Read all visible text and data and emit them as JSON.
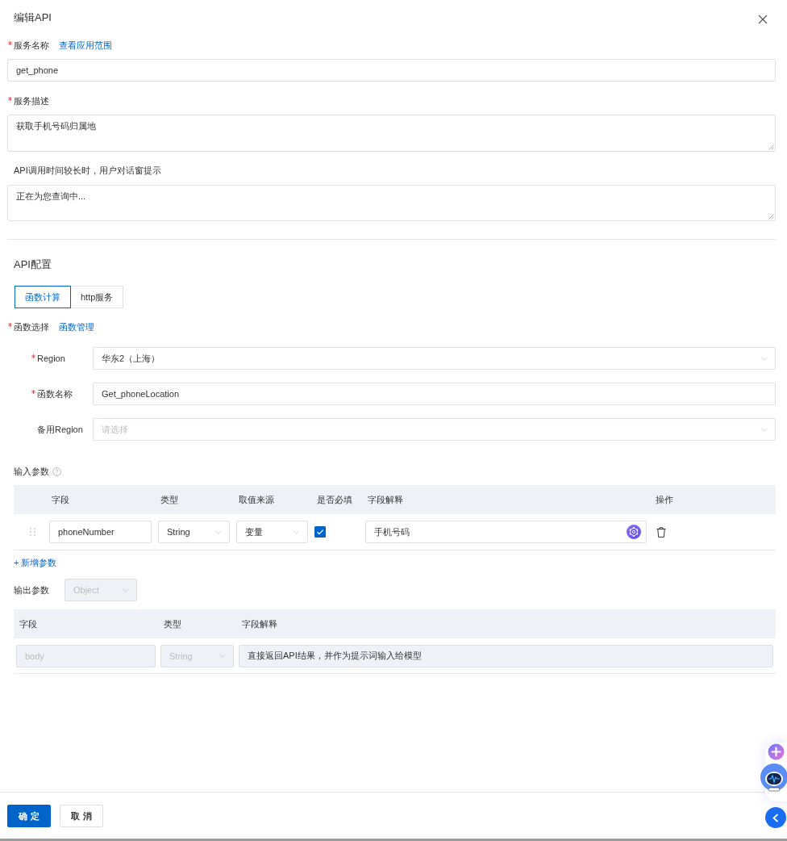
{
  "dialog": {
    "title": "编辑API"
  },
  "service_name": {
    "label": "服务名称",
    "required": true,
    "link": "查看应用范围",
    "value": "get_phone"
  },
  "service_description": {
    "label": "服务描述",
    "required": true,
    "value": "获取手机号码归属地"
  },
  "wait_prompt": {
    "label": "API调用时间较长时，用户对话窗提示",
    "required": false,
    "value": "正在为您查询中..."
  },
  "api_config": {
    "title": "API配置",
    "tabs": [
      {
        "label": "函数计算",
        "selected": true
      },
      {
        "label": "http服务",
        "selected": false
      }
    ],
    "function_select": {
      "label": "函数选择",
      "required": true,
      "link": "函数管理"
    },
    "fields": [
      {
        "label": "Region",
        "required": true,
        "kind": "select",
        "value": "华东2（上海）"
      },
      {
        "label": "函数名称",
        "required": true,
        "kind": "input",
        "value": "Get_phoneLocation"
      },
      {
        "label": "备用Region",
        "required": false,
        "kind": "select",
        "placeholder": "请选择"
      }
    ]
  },
  "input_params": {
    "title": "输入参数",
    "columns": [
      "字段",
      "类型",
      "取值来源",
      "是否必填",
      "字段解释",
      "操作"
    ],
    "rows": [
      {
        "field": "phoneNumber",
        "type": "String",
        "source": "变量",
        "required": true,
        "description": "手机号码"
      }
    ],
    "add_button": "+ 新增参数"
  },
  "output_params": {
    "title": "输出参数",
    "type": {
      "value": "Object",
      "disabled": true
    },
    "columns": [
      "字段",
      "类型",
      "字段解释"
    ],
    "rows": [
      {
        "field": {
          "value": "body",
          "disabled": true
        },
        "type": {
          "value": "String",
          "disabled": true
        },
        "description": {
          "value": "直接返回API结果，并作为提示词输入给模型",
          "readonly": true
        }
      }
    ]
  },
  "footer": {
    "buttons": [
      {
        "label": "确 定",
        "kind": "primary"
      },
      {
        "label": "取 消",
        "kind": "default"
      }
    ]
  }
}
